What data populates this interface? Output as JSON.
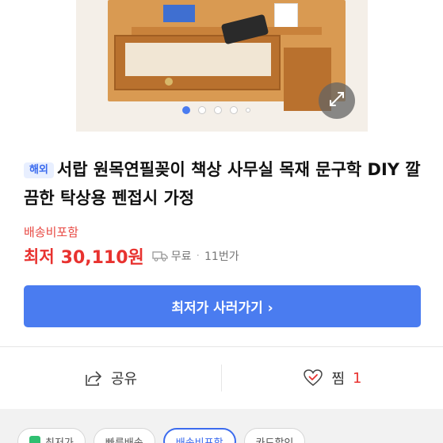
{
  "product": {
    "badge": "해외",
    "title": "서랍 원목연필꽂이 책상 사무실 목재 문구학 DIY 깔끔한 탁상용 펜접시 가정",
    "shipping_note": "배송비포함",
    "price_label": "최저",
    "price": "30,110원",
    "shipping_fee": "무료",
    "seller_count": "11번가"
  },
  "gallery": {
    "total_dots": 5,
    "active_index": 0,
    "zoom_icon": "expand-icon"
  },
  "buy": {
    "label": "최저가 사러가기 ›"
  },
  "actions": {
    "share_label": "공유",
    "like_label": "찜",
    "like_count": "1"
  },
  "chips": [
    "최저가",
    "빠른배송",
    "배송비포함",
    "카드할인"
  ],
  "colors": {
    "accent": "#4a7cf0",
    "price": "#e8322f",
    "badge_bg": "#e8efff"
  }
}
